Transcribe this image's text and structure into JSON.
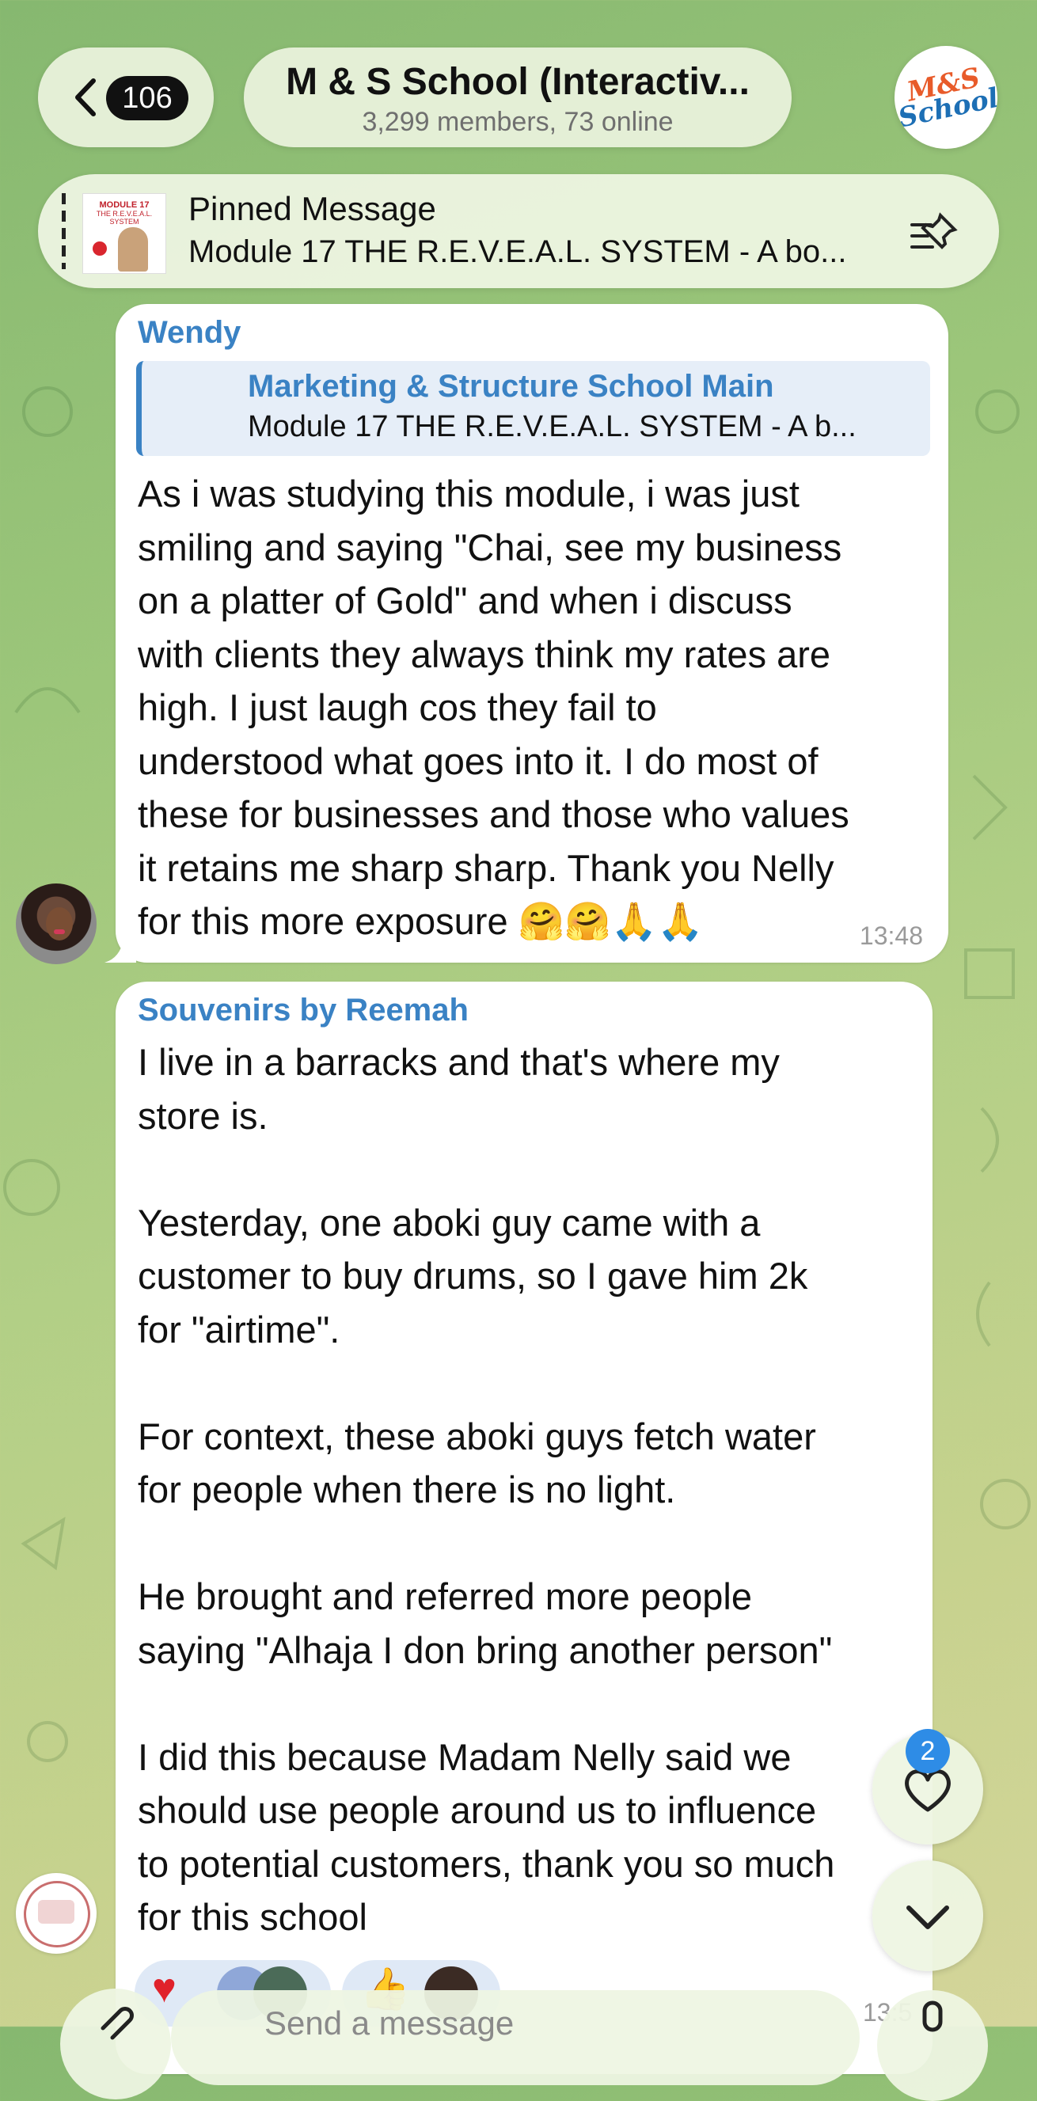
{
  "header": {
    "unread_count": "106",
    "chat_title": "M & S School (Interactiv...",
    "chat_subtitle": "3,299 members, 73 online",
    "avatar_logo_line1": "M&S",
    "avatar_logo_line2": "School"
  },
  "pinned": {
    "label": "Pinned Message",
    "text": "Module 17 THE R.E.V.E.A.L. SYSTEM - A bo...",
    "thumb_title": "MODULE 17",
    "thumb_subtitle": "THE R.E.V.E.A.L. SYSTEM"
  },
  "messages": [
    {
      "sender": "Wendy",
      "reply_to_name": "Marketing & Structure School Main",
      "reply_to_text": "Module 17 THE R.E.V.E.A.L. SYSTEM - A b...",
      "text": "As i was studying this module, i was just\nsmiling and saying \"Chai, see my business\non a platter of Gold\" and when i discuss\nwith clients they always think my rates are\nhigh. I just laugh cos they fail to\nunderstood what goes into it. I do most of\nthese for businesses and those who values\nit retains me sharp sharp. Thank you Nelly\nfor this more exposure 🤗🤗🙏🙏",
      "time": "13:48"
    },
    {
      "sender": "Souvenirs by Reemah",
      "text": "I live in a barracks and that's where my\nstore is.\n\nYesterday, one aboki guy came with a\ncustomer to buy drums, so I gave him 2k\nfor \"airtime\".\n\nFor context, these aboki guys fetch water\nfor people when there is no light.\n\nHe brought and referred more people\nsaying \"Alhaja I don bring another person\"\n\nI did this because Madam Nelly said we\nshould use people around us to influence\nto potential customers, thank you so much\nfor this school",
      "time": "13:5"
    }
  ],
  "floating": {
    "reaction_badge": "2"
  },
  "composer": {
    "placeholder": "Send a message"
  },
  "colors": {
    "accent": "#3a82c4",
    "badge": "#2e8ce6",
    "heart": "#e0222b"
  },
  "icons": [
    "back-chevron-icon",
    "pin-list-icon",
    "heart-icon",
    "chevron-down-icon",
    "paperclip-icon",
    "microphone-icon"
  ]
}
